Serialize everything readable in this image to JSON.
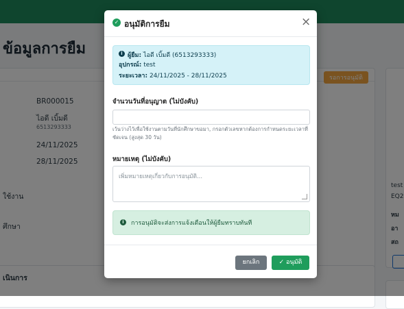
{
  "page": {
    "title": "ข้อมูลการยืม",
    "status_badge": "รอการอนุมัติ",
    "details": {
      "borrow_id": "BR000015",
      "borrower_name": "ไอดี เบิ้มดี",
      "borrower_id": "6513293333",
      "start_date": "24/11/2025",
      "end_date": "28/11/2025"
    },
    "left_labels": [
      "ใช้งาน",
      "ศึกษา",
      "เนินการ"
    ],
    "right_panel": [
      "test",
      "EQ2",
      "หม",
      "อา",
      "สถ"
    ]
  },
  "modal": {
    "title": "อนุมัติการยืม",
    "close_label": "×",
    "info": {
      "borrower_label": "ผู้ยืม:",
      "borrower_value": "ไอดี เบิ้มดี (6513293333)",
      "equipment_label": "อุปกรณ์:",
      "equipment_value": "test",
      "period_label": "ระยะเวลา:",
      "period_value": "24/11/2025 - 28/11/2025"
    },
    "days_field": {
      "label": "จำนวนวันที่อนุญาต (ไม่บังคับ)",
      "value": "",
      "help": "เว้นว่างไว้เพื่อใช้งานตามวันที่นักศึกษาขอมา, กรอกตัวเลขหากต้องการกำหนดระยะเวลาที่ชัดเจน (สูงสุด 30 วัน)"
    },
    "note_field": {
      "label": "หมายเหตุ (ไม่บังคับ)",
      "placeholder": "เพิ่มหมายเหตุเกี่ยวกับการอนุมัติ..."
    },
    "notice": "การอนุมัติจะส่งการแจ้งเตือนให้ผู้ยืมทราบทันที",
    "cancel_label": "ยกเลิก",
    "approve_label": "อนุมัติ"
  }
}
